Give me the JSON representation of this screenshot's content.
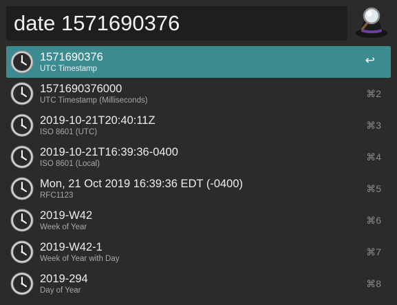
{
  "search": {
    "query": "date 1571690376"
  },
  "logo_icon": "alfred-hat-magnifier-icon",
  "results": [
    {
      "title": "1571690376",
      "subtitle": "UTC Timestamp",
      "shortcut": "↩",
      "icon": "clock-icon",
      "selected": true
    },
    {
      "title": "1571690376000",
      "subtitle": "UTC Timestamp (Milliseconds)",
      "shortcut": "⌘2",
      "icon": "clock-icon"
    },
    {
      "title": "2019-10-21T20:40:11Z",
      "subtitle": "ISO 8601 (UTC)",
      "shortcut": "⌘3",
      "icon": "clock-icon"
    },
    {
      "title": "2019-10-21T16:39:36-0400",
      "subtitle": "ISO 8601 (Local)",
      "shortcut": "⌘4",
      "icon": "clock-icon"
    },
    {
      "title": "Mon, 21 Oct 2019 16:39:36 EDT (-0400)",
      "subtitle": "RFC1123",
      "shortcut": "⌘5",
      "icon": "clock-icon"
    },
    {
      "title": "2019-W42",
      "subtitle": "Week of Year",
      "shortcut": "⌘6",
      "icon": "clock-icon"
    },
    {
      "title": "2019-W42-1",
      "subtitle": "Week of Year with Day",
      "shortcut": "⌘7",
      "icon": "clock-icon"
    },
    {
      "title": "2019-294",
      "subtitle": "Day of Year",
      "shortcut": "⌘8",
      "icon": "clock-icon"
    }
  ],
  "colors": {
    "background": "#2b2b2b",
    "search_field": "#1e1e1e",
    "selection": "#3c8b91",
    "title_text": "#ededed",
    "subtitle_text": "#a8a8a8",
    "shortcut_text": "#8a8a8a"
  }
}
